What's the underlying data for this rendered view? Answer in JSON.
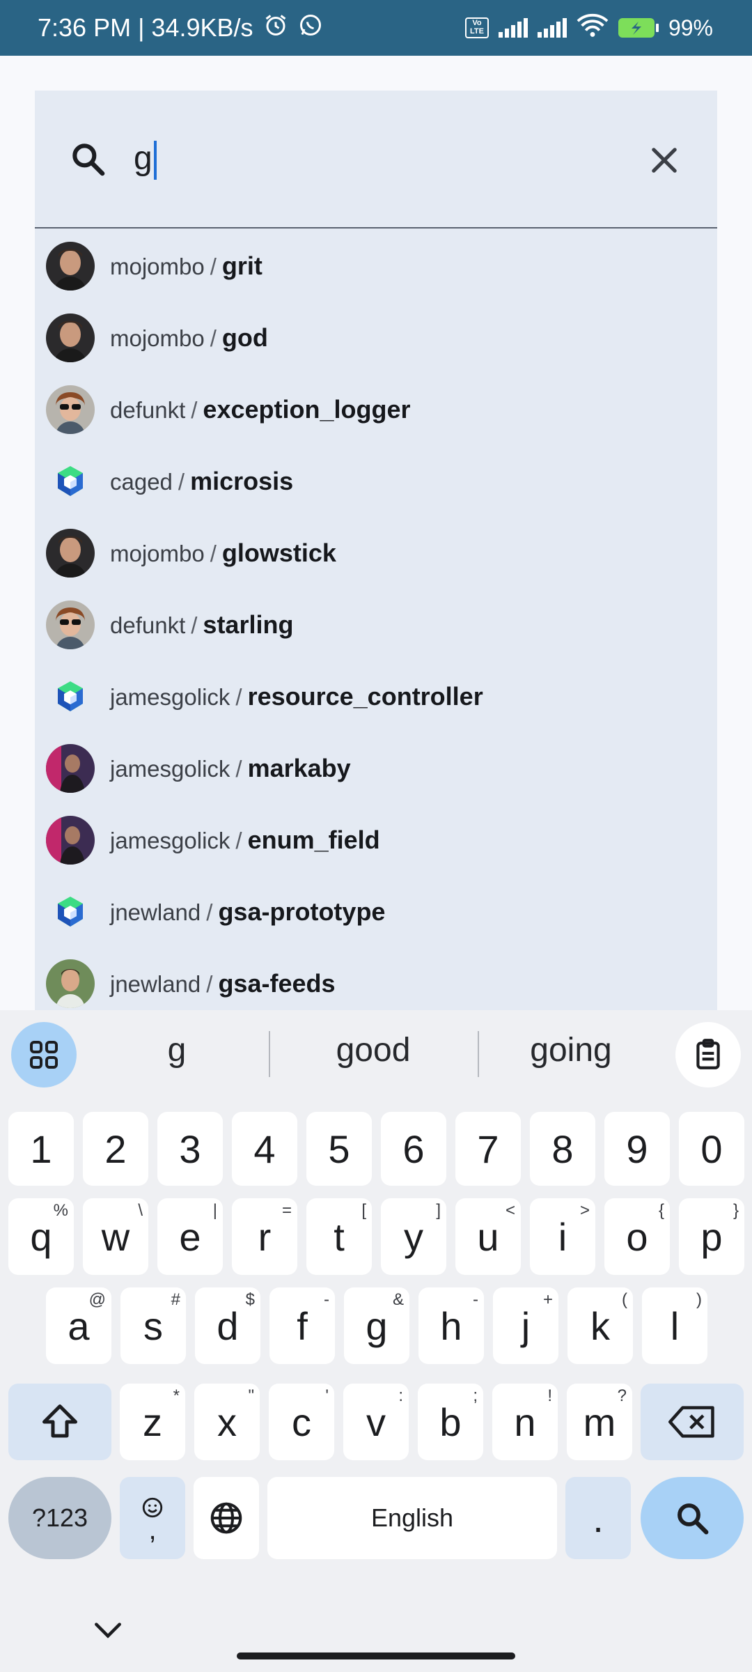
{
  "status_bar": {
    "time_speed": "7:36 PM | 34.9KB/s",
    "battery": "99%",
    "volte": "Vo LTE"
  },
  "search": {
    "value": "g",
    "search_icon": "search-icon",
    "clear_icon": "close-icon"
  },
  "results": [
    {
      "owner": "mojombo",
      "repo": "grit",
      "avatar": "mojombo"
    },
    {
      "owner": "mojombo",
      "repo": "god",
      "avatar": "mojombo"
    },
    {
      "owner": "defunkt",
      "repo": "exception_logger",
      "avatar": "defunkt"
    },
    {
      "owner": "caged",
      "repo": "microsis",
      "avatar": "hex"
    },
    {
      "owner": "mojombo",
      "repo": "glowstick",
      "avatar": "mojombo"
    },
    {
      "owner": "defunkt",
      "repo": "starling",
      "avatar": "defunkt"
    },
    {
      "owner": "jamesgolick",
      "repo": "resource_controller",
      "avatar": "hex"
    },
    {
      "owner": "jamesgolick",
      "repo": "markaby",
      "avatar": "jamesgolick"
    },
    {
      "owner": "jamesgolick",
      "repo": "enum_field",
      "avatar": "jamesgolick"
    },
    {
      "owner": "jnewland",
      "repo": "gsa-prototype",
      "avatar": "hex"
    },
    {
      "owner": "jnewland",
      "repo": "gsa-feeds",
      "avatar": "jnewland"
    }
  ],
  "separator": "/",
  "keyboard": {
    "suggestions": [
      "g",
      "good",
      "going"
    ],
    "number_row": [
      "1",
      "2",
      "3",
      "4",
      "5",
      "6",
      "7",
      "8",
      "9",
      "0"
    ],
    "row1": [
      {
        "k": "q",
        "h": "%"
      },
      {
        "k": "w",
        "h": "\\"
      },
      {
        "k": "e",
        "h": "|"
      },
      {
        "k": "r",
        "h": "="
      },
      {
        "k": "t",
        "h": "["
      },
      {
        "k": "y",
        "h": "]"
      },
      {
        "k": "u",
        "h": "<"
      },
      {
        "k": "i",
        "h": ">"
      },
      {
        "k": "o",
        "h": "{"
      },
      {
        "k": "p",
        "h": "}"
      }
    ],
    "row2": [
      {
        "k": "a",
        "h": "@"
      },
      {
        "k": "s",
        "h": "#"
      },
      {
        "k": "d",
        "h": "$"
      },
      {
        "k": "f",
        "h": "-"
      },
      {
        "k": "g",
        "h": "&"
      },
      {
        "k": "h",
        "h": "-"
      },
      {
        "k": "j",
        "h": "+"
      },
      {
        "k": "k",
        "h": "("
      },
      {
        "k": "l",
        "h": ")"
      }
    ],
    "row3": [
      {
        "k": "z",
        "h": "*"
      },
      {
        "k": "x",
        "h": "\""
      },
      {
        "k": "c",
        "h": "'"
      },
      {
        "k": "v",
        "h": ":"
      },
      {
        "k": "b",
        "h": ";"
      },
      {
        "k": "n",
        "h": "!"
      },
      {
        "k": "m",
        "h": "?"
      }
    ],
    "symbols_label": "?123",
    "emoji_comma": ",",
    "space_label": "English",
    "period": "."
  }
}
